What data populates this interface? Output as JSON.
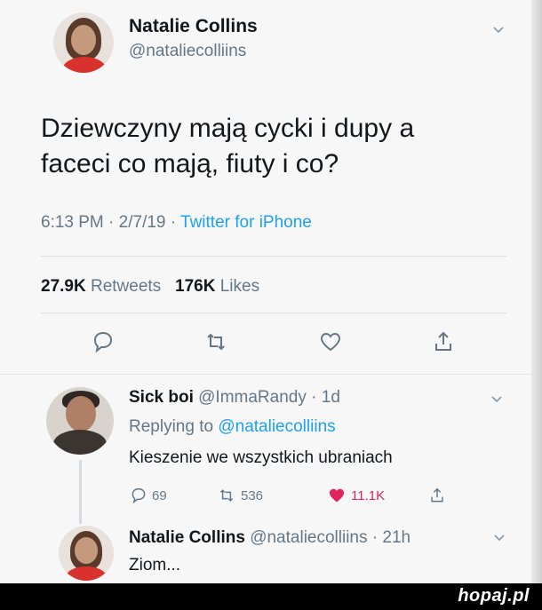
{
  "tweet": {
    "author_name": "Natalie Collins",
    "author_handle": "@nataliecolliins",
    "text_line1": "Dziewczyny mają cycki i dupy a",
    "text_line2": "faceci co mają, fiuty i co?",
    "time": "6:13 PM",
    "date": "2/7/19",
    "source": "Twitter for iPhone",
    "retweets_count": "27.9K",
    "retweets_label": "Retweets",
    "likes_count": "176K",
    "likes_label": "Likes",
    "icons": [
      "reply-icon",
      "retweet-icon",
      "like-icon",
      "share-icon"
    ]
  },
  "replies": [
    {
      "author_name": "Sick boi",
      "author_handle": "@ImmaRandy",
      "age": "1d",
      "replying_prefix": "Replying to",
      "replying_to": "@nataliecolliins",
      "text": "Kieszenie we wszystkich ubraniach",
      "reply_count": "69",
      "retweet_count": "536",
      "like_count": "11.1K",
      "liked": true
    },
    {
      "author_name": "Natalie Collins",
      "author_handle": "@nataliecolliins",
      "age": "21h",
      "text": "Ziom..."
    }
  ],
  "colors": {
    "accent": "#1da1f2",
    "muted": "#657786",
    "like": "#e0245e",
    "text": "#14171a"
  },
  "watermark": "hopaj.pl"
}
